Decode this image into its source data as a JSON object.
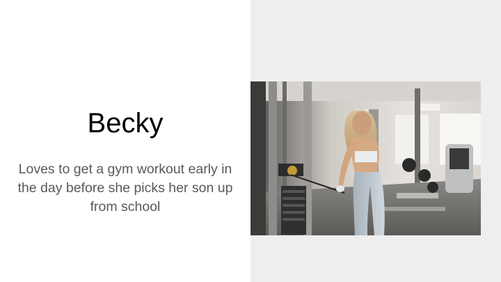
{
  "slide": {
    "title": "Becky",
    "body": "Loves to get a gym workout early in the day before she picks her son up from school"
  },
  "photo": {
    "subject": "woman-at-cable-machine"
  },
  "colors": {
    "background": "#ffffff",
    "right_panel": "#eeeeee",
    "title_text": "#000000",
    "body_text": "#595959"
  }
}
